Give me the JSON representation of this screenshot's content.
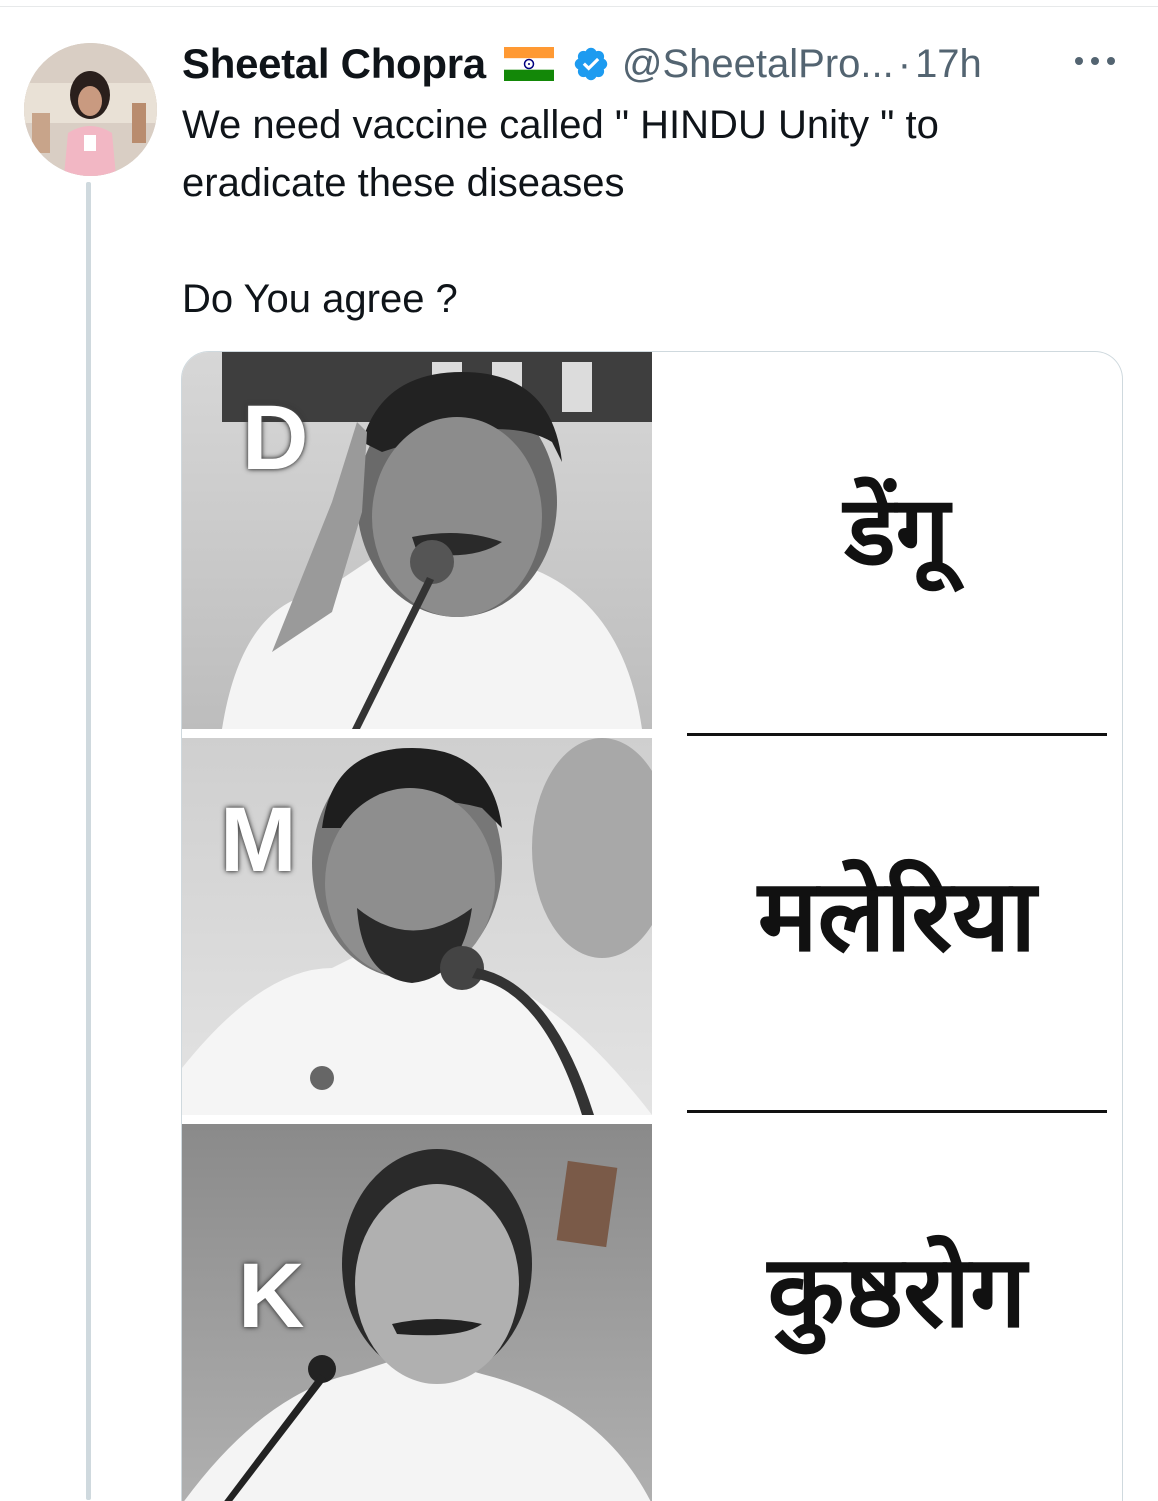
{
  "tweet": {
    "author": {
      "display_name": "Sheetal Chopra",
      "handle": "@SheetalPro...",
      "verified": true,
      "flag_icon": "india-flag-icon"
    },
    "separator": "·",
    "timestamp": "17h",
    "more_icon": "ellipsis-icon",
    "text_lines": [
      "We need vaccine called \" HINDU Unity \" to eradicate these diseases",
      "Do You agree ?"
    ]
  },
  "media": {
    "panels": [
      {
        "letter": "D",
        "word": "डेंगू"
      },
      {
        "letter": "M",
        "word": "मलेरिया"
      },
      {
        "letter": "K",
        "word": "कुष्ठरोग"
      }
    ]
  },
  "colors": {
    "text": "#0f1419",
    "secondary_text": "#536471",
    "verified_blue": "#1d9bf0",
    "border": "#cfd9de"
  }
}
